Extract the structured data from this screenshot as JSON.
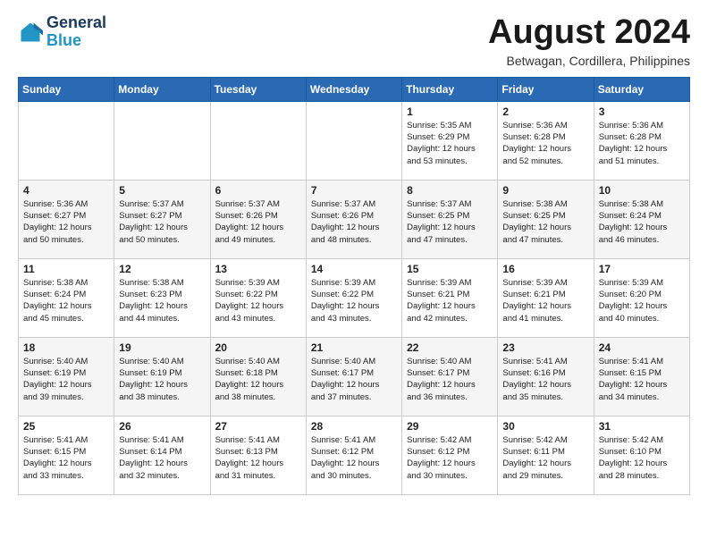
{
  "header": {
    "logo_line1": "General",
    "logo_line2": "Blue",
    "month_year": "August 2024",
    "location": "Betwagan, Cordillera, Philippines"
  },
  "weekdays": [
    "Sunday",
    "Monday",
    "Tuesday",
    "Wednesday",
    "Thursday",
    "Friday",
    "Saturday"
  ],
  "weeks": [
    [
      {
        "day": "",
        "detail": ""
      },
      {
        "day": "",
        "detail": ""
      },
      {
        "day": "",
        "detail": ""
      },
      {
        "day": "",
        "detail": ""
      },
      {
        "day": "1",
        "detail": "Sunrise: 5:35 AM\nSunset: 6:29 PM\nDaylight: 12 hours\nand 53 minutes."
      },
      {
        "day": "2",
        "detail": "Sunrise: 5:36 AM\nSunset: 6:28 PM\nDaylight: 12 hours\nand 52 minutes."
      },
      {
        "day": "3",
        "detail": "Sunrise: 5:36 AM\nSunset: 6:28 PM\nDaylight: 12 hours\nand 51 minutes."
      }
    ],
    [
      {
        "day": "4",
        "detail": "Sunrise: 5:36 AM\nSunset: 6:27 PM\nDaylight: 12 hours\nand 50 minutes."
      },
      {
        "day": "5",
        "detail": "Sunrise: 5:37 AM\nSunset: 6:27 PM\nDaylight: 12 hours\nand 50 minutes."
      },
      {
        "day": "6",
        "detail": "Sunrise: 5:37 AM\nSunset: 6:26 PM\nDaylight: 12 hours\nand 49 minutes."
      },
      {
        "day": "7",
        "detail": "Sunrise: 5:37 AM\nSunset: 6:26 PM\nDaylight: 12 hours\nand 48 minutes."
      },
      {
        "day": "8",
        "detail": "Sunrise: 5:37 AM\nSunset: 6:25 PM\nDaylight: 12 hours\nand 47 minutes."
      },
      {
        "day": "9",
        "detail": "Sunrise: 5:38 AM\nSunset: 6:25 PM\nDaylight: 12 hours\nand 47 minutes."
      },
      {
        "day": "10",
        "detail": "Sunrise: 5:38 AM\nSunset: 6:24 PM\nDaylight: 12 hours\nand 46 minutes."
      }
    ],
    [
      {
        "day": "11",
        "detail": "Sunrise: 5:38 AM\nSunset: 6:24 PM\nDaylight: 12 hours\nand 45 minutes."
      },
      {
        "day": "12",
        "detail": "Sunrise: 5:38 AM\nSunset: 6:23 PM\nDaylight: 12 hours\nand 44 minutes."
      },
      {
        "day": "13",
        "detail": "Sunrise: 5:39 AM\nSunset: 6:22 PM\nDaylight: 12 hours\nand 43 minutes."
      },
      {
        "day": "14",
        "detail": "Sunrise: 5:39 AM\nSunset: 6:22 PM\nDaylight: 12 hours\nand 43 minutes."
      },
      {
        "day": "15",
        "detail": "Sunrise: 5:39 AM\nSunset: 6:21 PM\nDaylight: 12 hours\nand 42 minutes."
      },
      {
        "day": "16",
        "detail": "Sunrise: 5:39 AM\nSunset: 6:21 PM\nDaylight: 12 hours\nand 41 minutes."
      },
      {
        "day": "17",
        "detail": "Sunrise: 5:39 AM\nSunset: 6:20 PM\nDaylight: 12 hours\nand 40 minutes."
      }
    ],
    [
      {
        "day": "18",
        "detail": "Sunrise: 5:40 AM\nSunset: 6:19 PM\nDaylight: 12 hours\nand 39 minutes."
      },
      {
        "day": "19",
        "detail": "Sunrise: 5:40 AM\nSunset: 6:19 PM\nDaylight: 12 hours\nand 38 minutes."
      },
      {
        "day": "20",
        "detail": "Sunrise: 5:40 AM\nSunset: 6:18 PM\nDaylight: 12 hours\nand 38 minutes."
      },
      {
        "day": "21",
        "detail": "Sunrise: 5:40 AM\nSunset: 6:17 PM\nDaylight: 12 hours\nand 37 minutes."
      },
      {
        "day": "22",
        "detail": "Sunrise: 5:40 AM\nSunset: 6:17 PM\nDaylight: 12 hours\nand 36 minutes."
      },
      {
        "day": "23",
        "detail": "Sunrise: 5:41 AM\nSunset: 6:16 PM\nDaylight: 12 hours\nand 35 minutes."
      },
      {
        "day": "24",
        "detail": "Sunrise: 5:41 AM\nSunset: 6:15 PM\nDaylight: 12 hours\nand 34 minutes."
      }
    ],
    [
      {
        "day": "25",
        "detail": "Sunrise: 5:41 AM\nSunset: 6:15 PM\nDaylight: 12 hours\nand 33 minutes."
      },
      {
        "day": "26",
        "detail": "Sunrise: 5:41 AM\nSunset: 6:14 PM\nDaylight: 12 hours\nand 32 minutes."
      },
      {
        "day": "27",
        "detail": "Sunrise: 5:41 AM\nSunset: 6:13 PM\nDaylight: 12 hours\nand 31 minutes."
      },
      {
        "day": "28",
        "detail": "Sunrise: 5:41 AM\nSunset: 6:12 PM\nDaylight: 12 hours\nand 30 minutes."
      },
      {
        "day": "29",
        "detail": "Sunrise: 5:42 AM\nSunset: 6:12 PM\nDaylight: 12 hours\nand 30 minutes."
      },
      {
        "day": "30",
        "detail": "Sunrise: 5:42 AM\nSunset: 6:11 PM\nDaylight: 12 hours\nand 29 minutes."
      },
      {
        "day": "31",
        "detail": "Sunrise: 5:42 AM\nSunset: 6:10 PM\nDaylight: 12 hours\nand 28 minutes."
      }
    ]
  ]
}
